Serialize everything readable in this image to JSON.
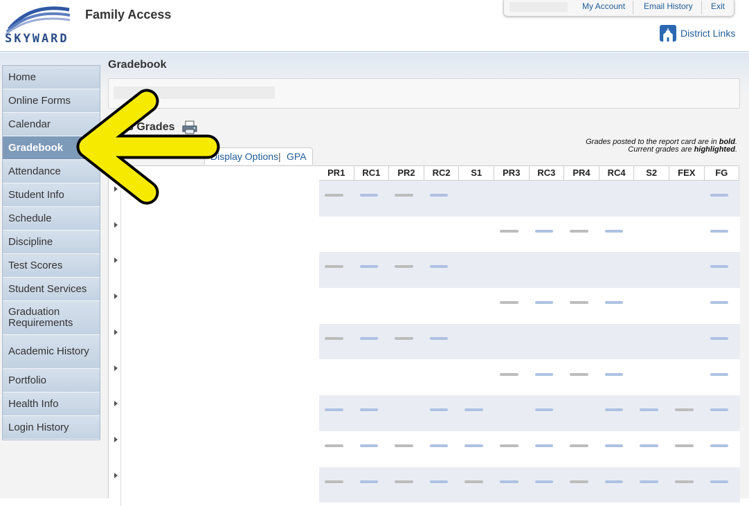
{
  "header": {
    "logo_text": "SKYWARD",
    "app_title": "Family Access",
    "links": [
      "My Account",
      "Email History",
      "Exit"
    ],
    "district_links": "District Links"
  },
  "sidebar": {
    "items": [
      {
        "label": "Home",
        "active": false
      },
      {
        "label": "Online Forms",
        "active": false
      },
      {
        "label": "Calendar",
        "active": false
      },
      {
        "label": "Gradebook",
        "active": true
      },
      {
        "label": "Attendance",
        "active": false
      },
      {
        "label": "Student Info",
        "active": false
      },
      {
        "label": "Schedule",
        "active": false
      },
      {
        "label": "Discipline",
        "active": false
      },
      {
        "label": "Test Scores",
        "active": false
      },
      {
        "label": "Student Services",
        "active": false
      },
      {
        "label": "Graduation Requirements",
        "active": false
      },
      {
        "label": "Academic History",
        "active": false
      },
      {
        "label": "Portfolio",
        "active": false
      },
      {
        "label": "Health Info",
        "active": false
      },
      {
        "label": "Login History",
        "active": false
      }
    ]
  },
  "main": {
    "page_title": "Gradebook",
    "section_title": "s Grades",
    "note_line1_pre": "Grades posted to the report card are in ",
    "note_line1_bold": "bold",
    "note_line2_pre": "Current grades are ",
    "note_line2_bold": "highlighted",
    "tabs": [
      "Display Options",
      "GPA"
    ],
    "tab_sep": "|",
    "columns": [
      "PR1",
      "RC1",
      "PR2",
      "RC2",
      "S1",
      "PR3",
      "RC3",
      "PR4",
      "RC4",
      "S2",
      "FEX",
      "FG"
    ],
    "row_count": 9,
    "row_patterns": [
      [
        "g",
        "b",
        "g",
        "b",
        "",
        "",
        "",
        "",
        "",
        "",
        "",
        "b"
      ],
      [
        "",
        "",
        "",
        "",
        "",
        "g",
        "b",
        "g",
        "b",
        "",
        "",
        "b"
      ],
      [
        "g",
        "b",
        "g",
        "b",
        "",
        "",
        "",
        "",
        "",
        "",
        "",
        "b"
      ],
      [
        "",
        "",
        "",
        "",
        "",
        "g",
        "b",
        "g",
        "b",
        "",
        "",
        "b"
      ],
      [
        "g",
        "b",
        "g",
        "b",
        "",
        "",
        "",
        "",
        "",
        "",
        "",
        "b"
      ],
      [
        "",
        "",
        "",
        "",
        "",
        "g",
        "b",
        "g",
        "b",
        "",
        "",
        "b"
      ],
      [
        "b",
        "b",
        "",
        "b",
        "b",
        "",
        "b",
        "",
        "b",
        "b",
        "g",
        "b"
      ],
      [
        "g",
        "b",
        "g",
        "b",
        "b",
        "g",
        "b",
        "g",
        "b",
        "b",
        "g",
        "b"
      ],
      [
        "g",
        "b",
        "g",
        "b",
        "g",
        "b",
        "b",
        "g",
        "b",
        "b",
        "g",
        "b"
      ]
    ]
  },
  "annotation": {
    "arrow_color": "#f6ea00",
    "outline_color": "#000000"
  }
}
